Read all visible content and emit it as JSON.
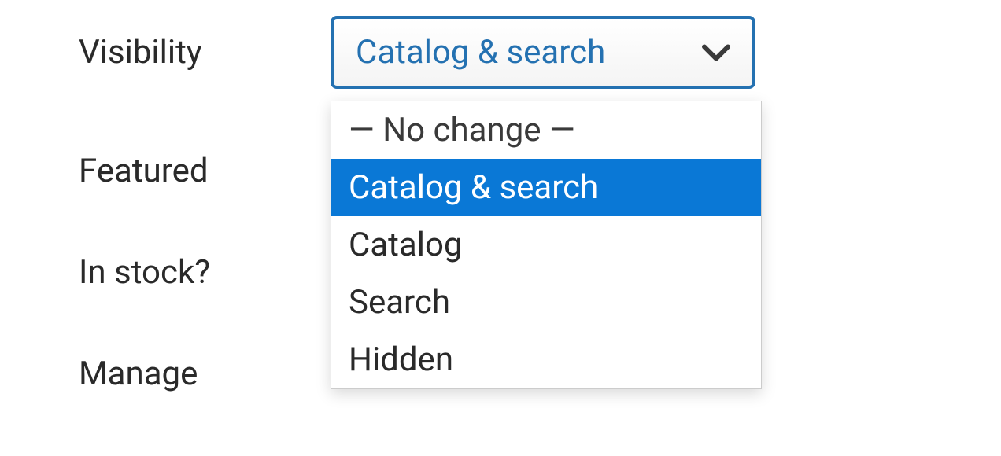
{
  "fields": {
    "visibility": {
      "label": "Visibility",
      "selected": "Catalog & search",
      "options": [
        {
          "label": "— No change —",
          "nochange": true
        },
        {
          "label": "Catalog & search",
          "selected": true
        },
        {
          "label": "Catalog"
        },
        {
          "label": "Search"
        },
        {
          "label": "Hidden"
        }
      ]
    },
    "featured": {
      "label": "Featured"
    },
    "instock": {
      "label": "In stock?"
    },
    "manage": {
      "label": "Manage"
    }
  }
}
